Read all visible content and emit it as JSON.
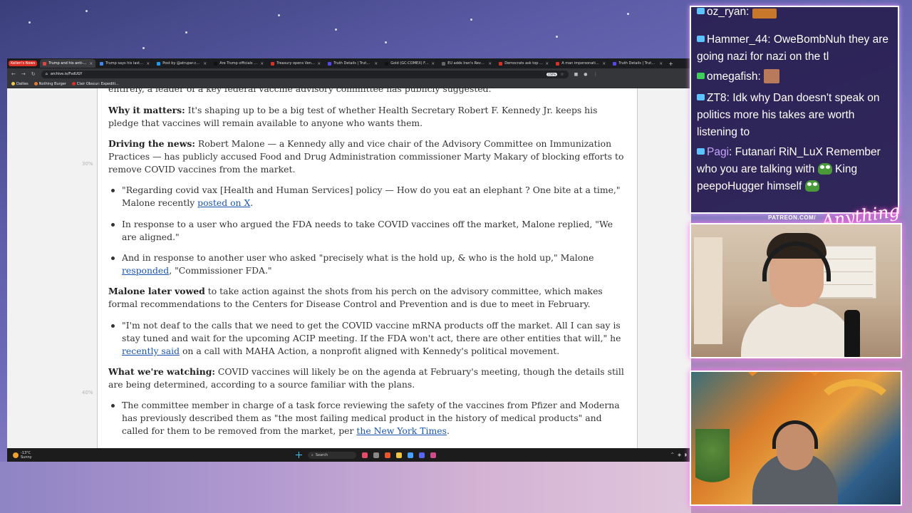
{
  "browser": {
    "tab_badge": "Kellen's News",
    "tabs": [
      {
        "label": "Trump and his anti-vax allie",
        "color": "#e04444",
        "active": true
      },
      {
        "label": "Trump says his last Cabinet",
        "color": "#4285f4"
      },
      {
        "label": "Post by @atrupar.com",
        "color": "#1d9bf0"
      },
      {
        "label": "Are Trump officials driving",
        "color": "#111111"
      },
      {
        "label": "Treasury opens Venezuelan",
        "color": "#d93025"
      },
      {
        "label": "Truth Details | Truth Social",
        "color": "#5448ee"
      },
      {
        "label": "Gold (GC:COMEX) Future Conti",
        "color": "#111111"
      },
      {
        "label": "EU adds Iran's Revolutionary",
        "color": "#666666"
      },
      {
        "label": "Democrats ask top US spy",
        "color": "#d93025"
      },
      {
        "label": "A man impersonating FBI a",
        "color": "#d93025"
      },
      {
        "label": "Truth Details | Truth Social",
        "color": "#5448ee"
      }
    ],
    "address": "archive.is/FsdUGY",
    "zoom": "150%",
    "bookmarks": [
      {
        "label": "Dailies",
        "color": "#f2c94c"
      },
      {
        "label": "Nothing Burger",
        "color": "#e07b39"
      },
      {
        "label": "Clair Obscur: Expediti...",
        "color": "#d93025"
      }
    ]
  },
  "scroll_markers": [
    "30%",
    "40%"
  ],
  "article": {
    "p0": "entirely, a leader of a key federal vaccine advisory committee has publicly suggested.",
    "why_label": "Why it matters:",
    "why_text": " It's shaping up to be a big test of whether Health Secretary Robert F. Kennedy Jr. keeps his pledge that vaccines will remain available to anyone who wants them.",
    "driving_label": "Driving the news:",
    "driving_text": " Robert Malone — a Kennedy ally and vice chair of the Advisory Committee on Immunization Practices — has publicly accused Food and Drug Administration commissioner Marty Makary of blocking efforts to remove COVID vaccines from the market.",
    "b1_text": "\"Regarding covid vax [Health and Human Services] policy — How do you eat an elephant ? One bite at a time,\" Malone recently ",
    "b1_link": "posted on X",
    "b1_end": ".",
    "b2_text": "In response to a user who argued the FDA needs to take COVID vaccines off the market, Malone replied, \"We are aligned.\"",
    "b3_text": "And in response to another user who asked \"precisely what is the hold up, & who is the hold up,\" Malone ",
    "b3_link": "responded",
    "b3_end": ", \"Commissioner FDA.\"",
    "later_label": "Malone later vowed",
    "later_text": " to take action against the shots from his perch on the advisory committee, which makes formal recommendations to the Centers for Disease Control and Prevention and is due to meet in February.",
    "b4_text": "\"I'm not deaf to the calls that we need to get the COVID vaccine mRNA products off the market. All I can say is stay tuned and wait for the upcoming ACIP meeting. If the FDA won't act, there are other entities that will,\" he ",
    "b4_link": "recently said",
    "b4_end": " on a call with MAHA Action, a nonprofit aligned with Kennedy's political movement.",
    "watching_label": "What we're watching:",
    "watching_text": " COVID vaccines will likely be on the agenda at February's meeting, though the details still are being determined, according to a source familiar with the plans.",
    "b5_text": "The committee member in charge of a task force reviewing the safety of the vaccines from Pfizer and Moderna has previously described them as \"the most failing medical product in the history of medical products\" and called for them to be removed from the market, per ",
    "b5_link": "the New York Times",
    "b5_end": "."
  },
  "taskbar": {
    "temp": "-13°C",
    "condition": "Sunny",
    "search": "Search"
  },
  "chat": [
    {
      "user": "oz_ryan",
      "text": "",
      "badge": "blue"
    },
    {
      "user": "Hammer_44",
      "text": "OweBombNuh they are going nazi for nazi on the tl",
      "badge": "blue"
    },
    {
      "user": "omegafish",
      "text": "",
      "badge": "green"
    },
    {
      "user": "ZT8",
      "text": "Idk why Dan doesn't speak on politics more his takes are worth listening to",
      "badge": "blue"
    },
    {
      "user": "Pagi",
      "text": "Futanari RiN_LuX Remember who you are talking with",
      "text2": "King peepoHugger himself",
      "badge": "blue"
    }
  ],
  "overlay": {
    "patreon": "PATREON.COM/",
    "signature": "Anything Else?"
  }
}
